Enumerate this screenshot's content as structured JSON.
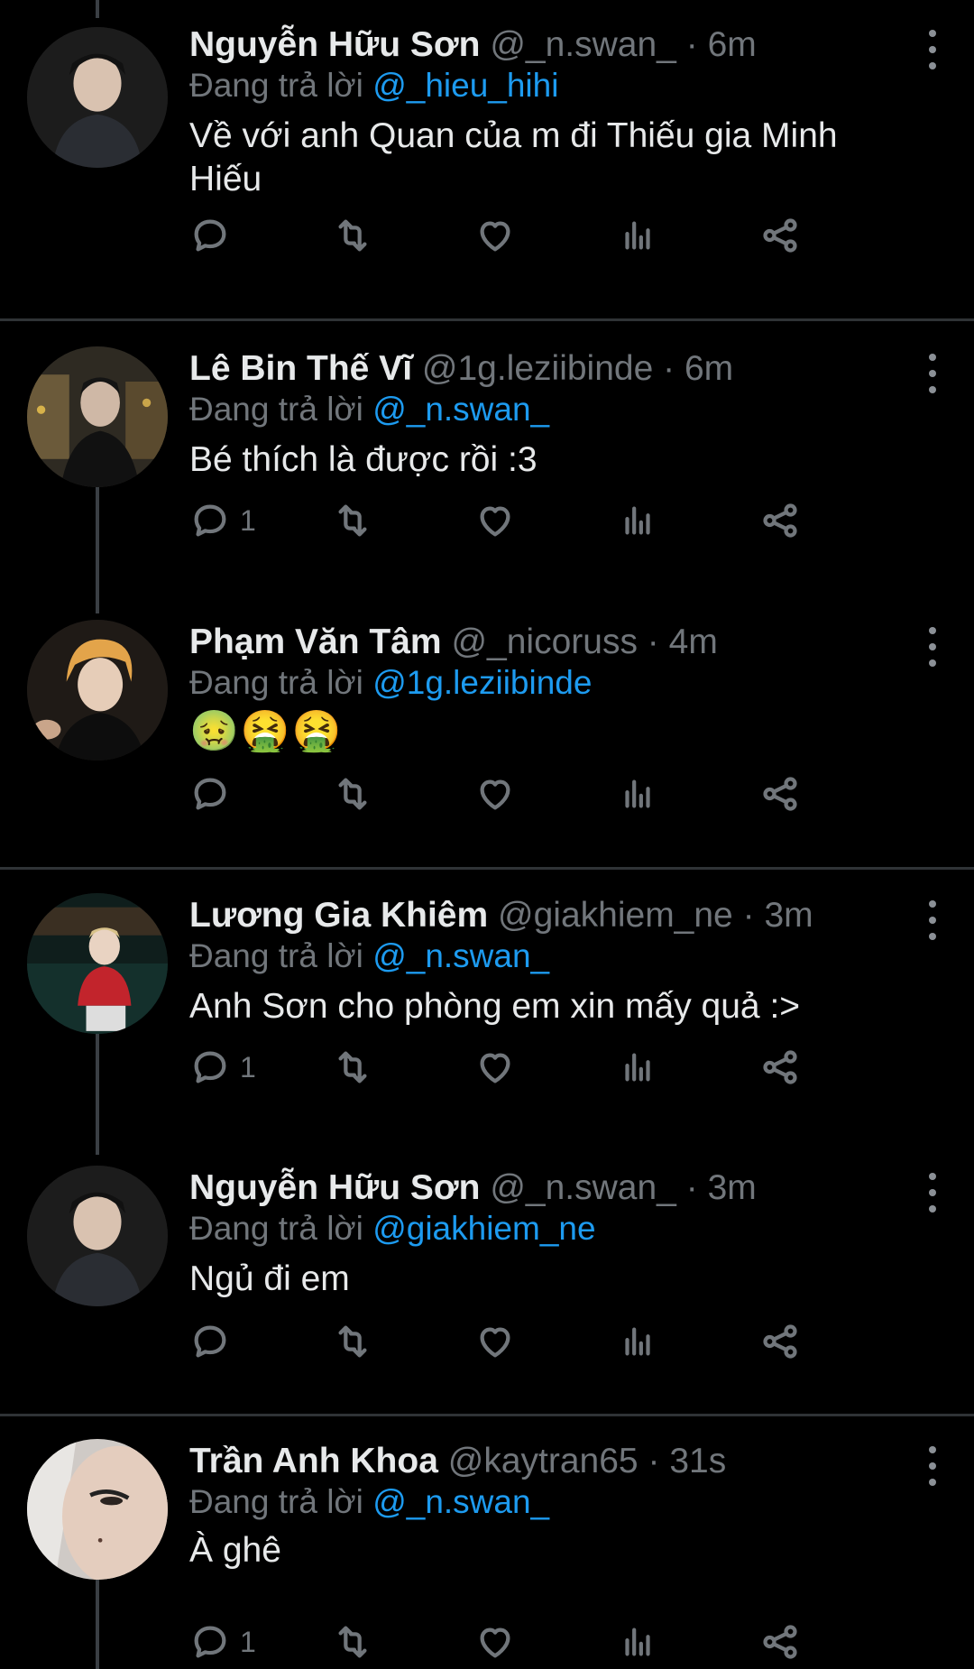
{
  "reply_prefix": "Đang trả lời",
  "tweets": [
    {
      "name": "Nguyễn Hữu Sơn",
      "handle": "@_n.swan_",
      "time": "6m",
      "replying_to": "@_hieu_hihi",
      "text_line1": "Về với anh Quan của m đi Thiếu gia Minh",
      "text_line2": "Hiếu",
      "reply_count": ""
    },
    {
      "name": "Lê Bin Thế Vĩ",
      "handle": "@1g.leziibinde",
      "time": "6m",
      "replying_to": "@_n.swan_",
      "text_line1": "Bé thích là được rồi :3",
      "text_line2": "",
      "reply_count": "1"
    },
    {
      "name": "Phạm Văn Tâm",
      "handle": "@_nicoruss",
      "time": "4m",
      "replying_to": "@1g.leziibinde",
      "text_line1": "🤢🤮🤮",
      "text_line2": "",
      "reply_count": ""
    },
    {
      "name": "Lương Gia Khiêm",
      "handle": "@giakhiem_ne",
      "time": "3m",
      "replying_to": "@_n.swan_",
      "text_line1": "Anh Sơn cho phòng em xin mấy quả :>",
      "text_line2": "",
      "reply_count": "1"
    },
    {
      "name": "Nguyễn Hữu Sơn",
      "handle": "@_n.swan_",
      "time": "3m",
      "replying_to": "@giakhiem_ne",
      "text_line1": "Ngủ đi em",
      "text_line2": "",
      "reply_count": ""
    },
    {
      "name": "Trần Anh Khoa",
      "handle": "@kaytran65",
      "time": "31s",
      "replying_to": "@_n.swan_",
      "text_line1": "À ghê",
      "text_line2": "",
      "reply_count": "1"
    }
  ],
  "icons": {
    "reply": "reply-icon",
    "retweet": "retweet-icon",
    "like": "heart-icon",
    "views": "views-icon",
    "share": "share-icon",
    "more": "more-vertical-icon"
  }
}
